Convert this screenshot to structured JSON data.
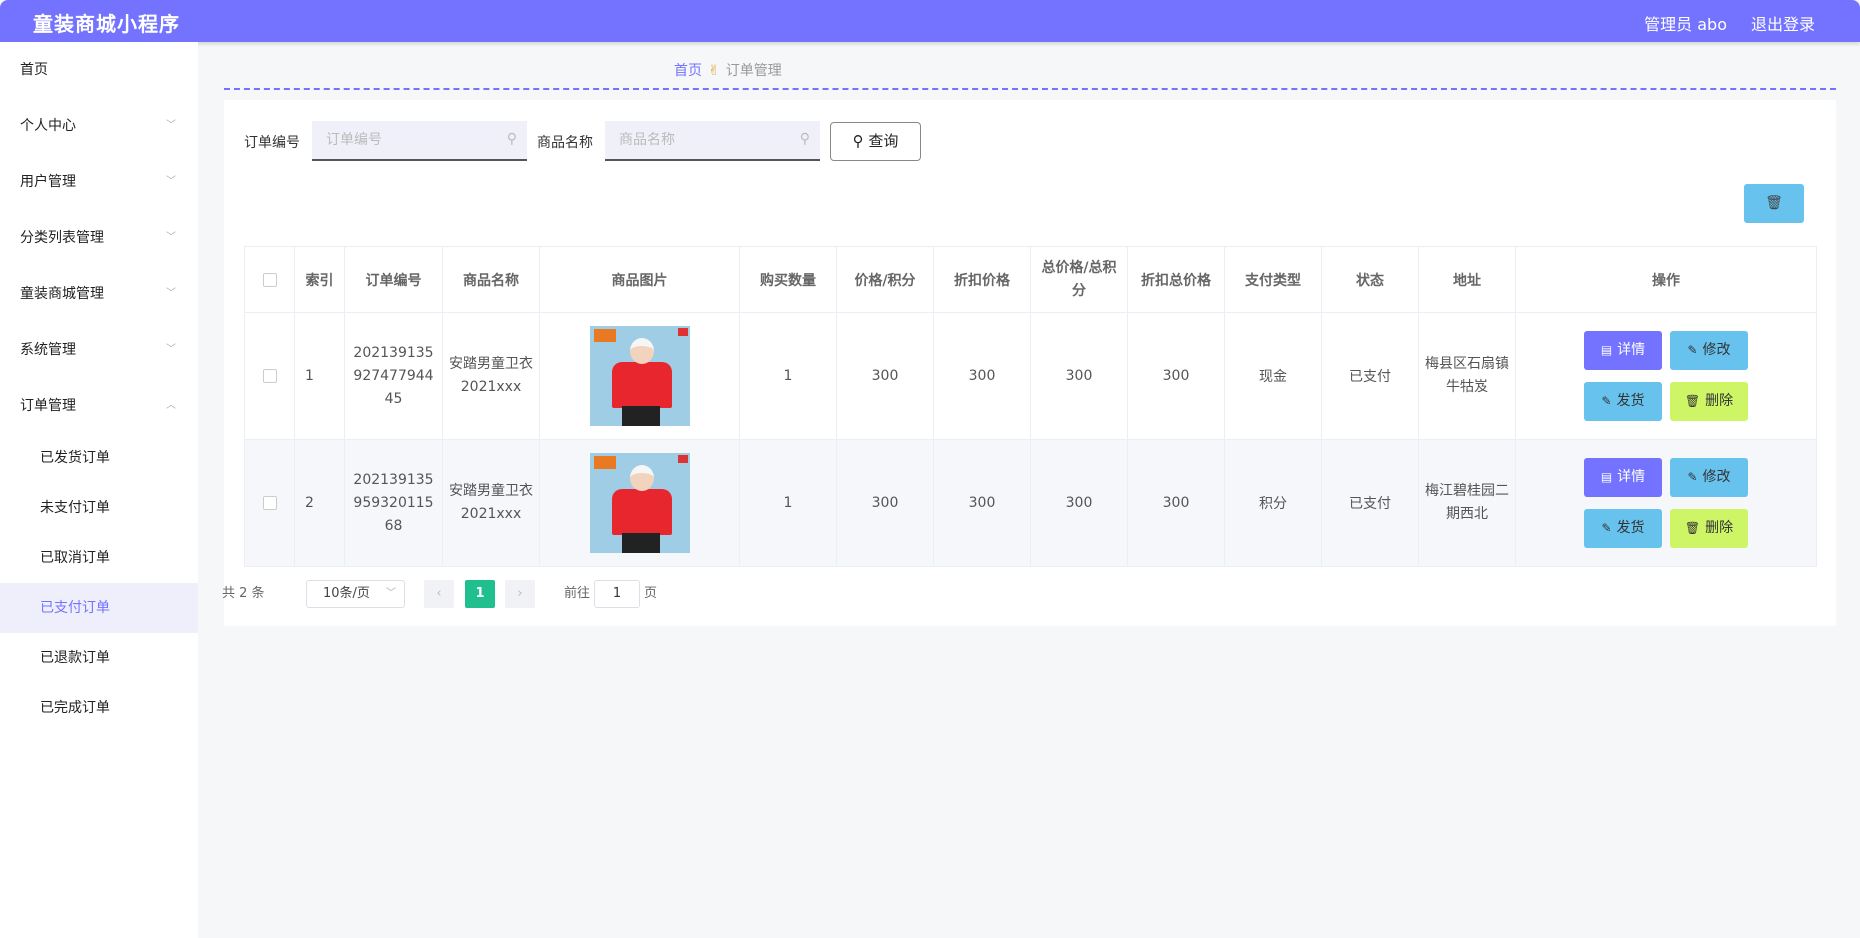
{
  "header": {
    "app_title": "童装商城小程序",
    "admin_label": "管理员 abo",
    "logout": "退出登录"
  },
  "sidebar": {
    "home": "首页",
    "groups": [
      {
        "label": "个人中心",
        "icon": "chevron-down-icon"
      },
      {
        "label": "用户管理",
        "icon": "chevron-down-icon"
      },
      {
        "label": "分类列表管理",
        "icon": "chevron-down-icon"
      },
      {
        "label": "童装商城管理",
        "icon": "chevron-down-icon"
      },
      {
        "label": "系统管理",
        "icon": "chevron-down-icon"
      },
      {
        "label": "订单管理",
        "icon": "chevron-up-icon"
      }
    ],
    "sub_items": [
      "已发货订单",
      "未支付订单",
      "已取消订单",
      "已支付订单",
      "已退款订单",
      "已完成订单"
    ],
    "active_sub": "已支付订单"
  },
  "breadcrumb": {
    "home": "首页",
    "separator_icon": "hand-icon",
    "current": "订单管理"
  },
  "search": {
    "order_no_label": "订单编号",
    "order_no_placeholder": "订单编号",
    "goods_name_label": "商品名称",
    "goods_name_placeholder": "商品名称",
    "query_button": "查询",
    "batch_delete_icon": "trash-icon"
  },
  "table": {
    "headers": [
      "索引",
      "订单编号",
      "商品名称",
      "商品图片",
      "购买数量",
      "价格/积分",
      "折扣价格",
      "总价格/总积分",
      "折扣总价格",
      "支付类型",
      "状态",
      "地址",
      "操作"
    ],
    "rows": [
      {
        "index": "1",
        "order_no": "20213913592747794445",
        "goods_name": "安踏男童卫衣2021xxx",
        "qty": "1",
        "price": "300",
        "discount_price": "300",
        "total": "300",
        "discount_total": "300",
        "pay_type": "现金",
        "status": "已支付",
        "address": "梅县区石扇镇牛牯岌"
      },
      {
        "index": "2",
        "order_no": "20213913595932011568",
        "goods_name": "安踏男童卫衣2021xxx",
        "qty": "1",
        "price": "300",
        "discount_price": "300",
        "total": "300",
        "discount_total": "300",
        "pay_type": "积分",
        "status": "已支付",
        "address": "梅江碧桂园二期西北"
      }
    ],
    "actions": {
      "detail": "详情",
      "edit": "修改",
      "ship": "发货",
      "delete": "删除"
    }
  },
  "pagination": {
    "total": "共 2 条",
    "page_size": "10条/页",
    "current_page": "1",
    "goto": "前往",
    "goto_value": "1",
    "page_suffix": "页"
  },
  "colors": {
    "primary": "#7373ff",
    "info": "#67c2ee",
    "danger_light": "#cdf565",
    "pager_active": "#1fc08e"
  }
}
